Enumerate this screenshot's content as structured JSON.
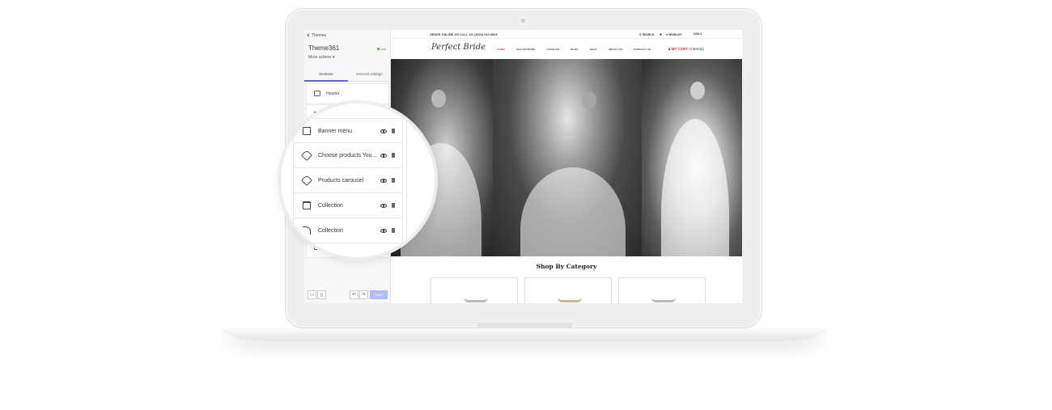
{
  "editor": {
    "back_label": "Themes",
    "theme_name": "Theme361",
    "live_label": "Live",
    "more_actions": "More actions",
    "tabs": [
      {
        "label": "Sections"
      },
      {
        "label": "General settings"
      }
    ],
    "header_section": "Header",
    "save_label": "Save"
  },
  "magnifier": {
    "rows": [
      {
        "label": "Banner menu",
        "icon": "banner-icon"
      },
      {
        "label": "Choose products You...",
        "icon": "tag-icon"
      },
      {
        "label": "Products carousel",
        "icon": "tag-icon"
      },
      {
        "label": "Collection",
        "icon": "collection-icon"
      },
      {
        "label": "Collection",
        "icon": "collection-icon"
      }
    ]
  },
  "store": {
    "topbar": {
      "order_text": "ORDER ONLINE OR CALL US (1800) 000 8808",
      "search": "SEARCH",
      "wishlist": "WISHLIST",
      "currency": "USD"
    },
    "logo": "Perfect Bride",
    "nav": [
      "HOME",
      "COLLECTIONS",
      "CATALOG",
      "BLOG",
      "SALE",
      "ABOUT US",
      "CONTACT US"
    ],
    "cart_label": "MY CART:",
    "cart_count": "0 item(s)",
    "category_title": "Shop By Category"
  },
  "colors": {
    "accent_red": "#c4343c",
    "save_button": "#b3bcf5",
    "tab_active": "#5c6ac4",
    "live_green": "#50b83c"
  }
}
